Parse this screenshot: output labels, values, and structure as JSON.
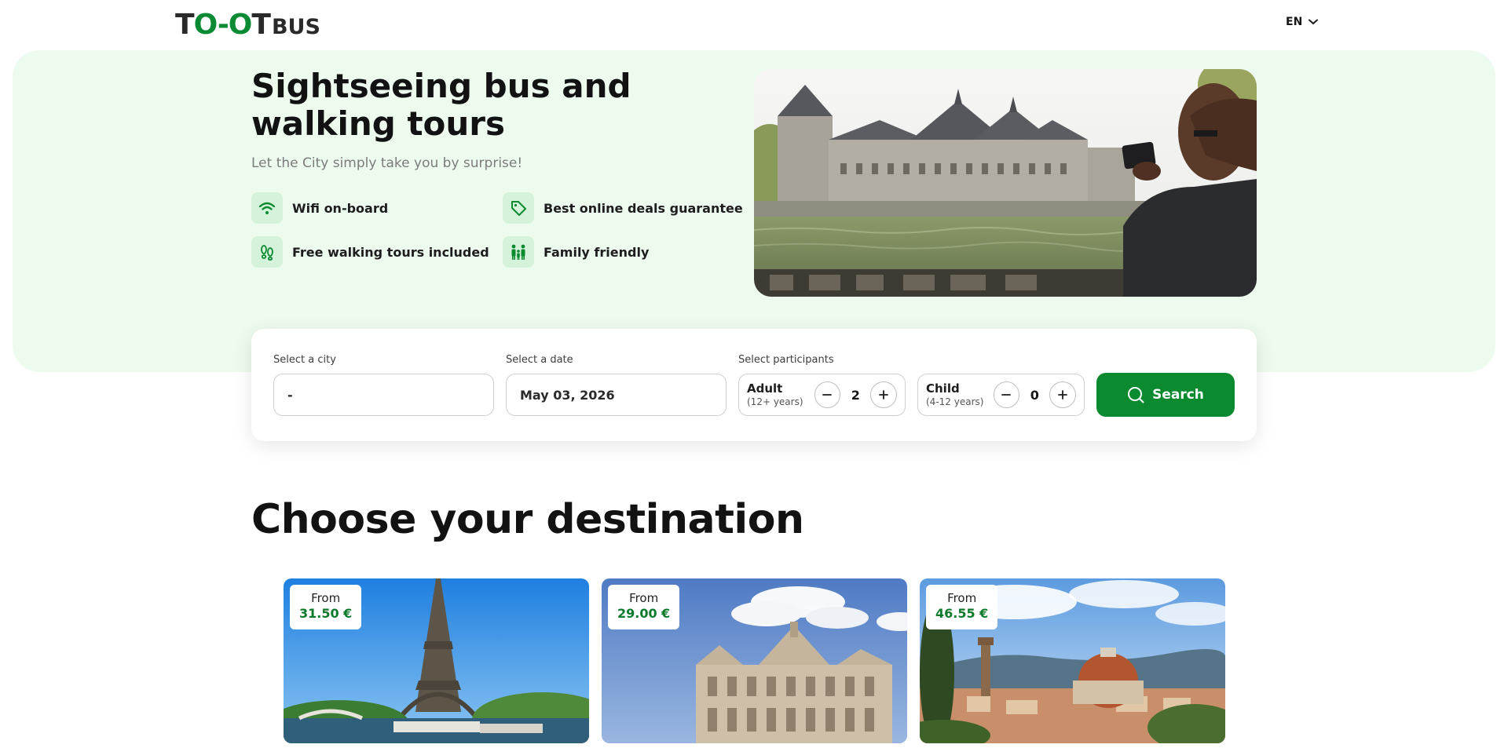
{
  "header": {
    "logo_text": "TOOTBUS",
    "language": "EN"
  },
  "hero": {
    "title": "Sightseeing bus and walking tours",
    "subtitle": "Let the City simply take you by surprise!",
    "features": [
      {
        "label": "Wifi on-board",
        "icon": "wifi-icon"
      },
      {
        "label": "Best online deals guarantee",
        "icon": "tag-icon"
      },
      {
        "label": "Free walking tours included",
        "icon": "footprints-icon"
      },
      {
        "label": "Family friendly",
        "icon": "family-icon"
      }
    ]
  },
  "search": {
    "city_label": "Select a city",
    "city_value": "-",
    "date_label": "Select a date",
    "date_value": "May 03, 2026",
    "participants_label": "Select participants",
    "adult": {
      "name": "Adult",
      "age": "(12+ years)",
      "count": "2"
    },
    "child": {
      "name": "Child",
      "age": "(4-12 years)",
      "count": "0"
    },
    "button_label": "Search"
  },
  "destinations": {
    "title": "Choose your destination",
    "cards": [
      {
        "from_label": "From",
        "price": "31.50 €"
      },
      {
        "from_label": "From",
        "price": "29.00 €"
      },
      {
        "from_label": "From",
        "price": "46.55 €"
      }
    ]
  },
  "colors": {
    "brand_green": "#0c8a30",
    "hero_bg": "#edfbef",
    "price_green": "#0b7a2b"
  }
}
